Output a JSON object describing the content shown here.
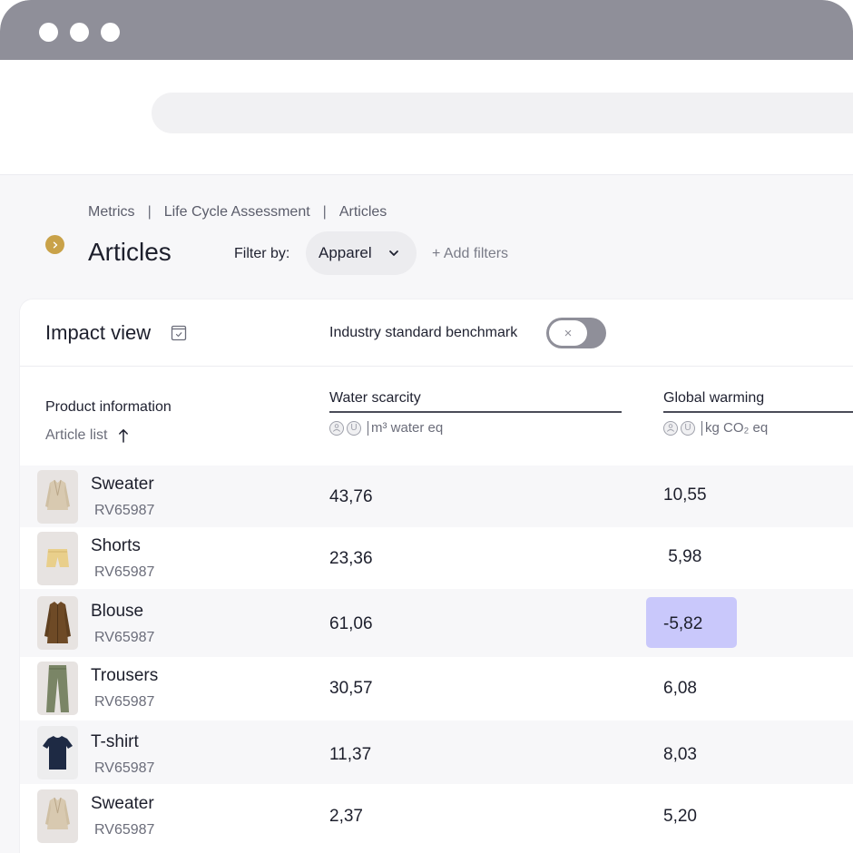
{
  "breadcrumb": [
    "Metrics",
    "Life Cycle Assessment",
    "Articles"
  ],
  "breadcrumb_separator": "|",
  "page_title": "Articles",
  "filter": {
    "label": "Filter by:",
    "selected": "Apparel",
    "add_label": "+ Add filters"
  },
  "card": {
    "title": "Impact view",
    "benchmark_label": "Industry standard benchmark",
    "benchmark_enabled": false,
    "toggle_glyph": "×"
  },
  "columns": {
    "product": "Product information",
    "sort_label": "Article list",
    "metrics": [
      {
        "name": "Water scarcity",
        "unit": "m³ water eq"
      },
      {
        "name": "Global warming",
        "unit": "kg CO₂ eq"
      }
    ],
    "unit_icon_glyph": "U"
  },
  "rows": [
    {
      "name": "Sweater",
      "code": "RV65987",
      "water": "43,76",
      "warming": "10,55",
      "thumb": "sweater-beige",
      "highlight": false
    },
    {
      "name": "Shorts",
      "code": "RV65987",
      "water": "23,36",
      "warming": " 5,98",
      "thumb": "shorts-yellow",
      "highlight": false
    },
    {
      "name": "Blouse",
      "code": "RV65987",
      "water": "61,06",
      "warming": "-5,82",
      "thumb": "blouse-brown",
      "highlight": true
    },
    {
      "name": "Trousers",
      "code": "RV65987",
      "water": "30,57",
      "warming": "6,08",
      "thumb": "trousers-olive",
      "highlight": false
    },
    {
      "name": "T-shirt",
      "code": "RV65987",
      "water": "11,37",
      "warming": "8,03",
      "thumb": "tshirt-navy",
      "highlight": false
    },
    {
      "name": "Sweater",
      "code": "RV65987",
      "water": "2,37",
      "warming": "5,20",
      "thumb": "sweater-beige",
      "highlight": false
    }
  ],
  "colors": {
    "titlebar": "#8f8f99",
    "accent_gold": "#c9a249",
    "highlight": "#c9c8fb"
  },
  "icons": {
    "expand": "chevron-right-icon",
    "impact": "calendar-check-icon",
    "sort": "arrow-up-icon",
    "filter_dropdown": "chevron-down-icon"
  }
}
